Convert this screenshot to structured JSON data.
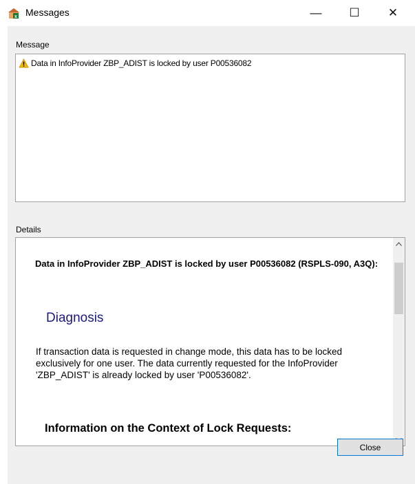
{
  "window": {
    "title": "Messages",
    "minimize_glyph": "—",
    "maximize_glyph": "☐",
    "close_glyph": "✕"
  },
  "icons": {
    "app": "sap-app-icon",
    "warning": "warning-icon"
  },
  "message_section": {
    "label": "Message",
    "items": [
      {
        "icon": "warning-icon",
        "text": "Data in InfoProvider ZBP_ADIST is locked by user P00536082"
      }
    ]
  },
  "details_section": {
    "label": "Details",
    "heading": "Data in InfoProvider ZBP_ADIST is locked by user P00536082 (RSPLS-090, A3Q):",
    "diagnosis_title": "Diagnosis",
    "diagnosis_text": "If transaction data is requested in change mode, this data has to be locked exclusively for one user. The data currently requested for the InfoProvider 'ZBP_ADIST' is already locked by user 'P00536082'.",
    "context_title": "Information on the Context of Lock Requests:"
  },
  "buttons": {
    "close_label": "Close"
  },
  "colors": {
    "dialog_background": "#f0f0f0",
    "diagnosis_title": "#1a1a80",
    "button_border": "#0078d7"
  }
}
